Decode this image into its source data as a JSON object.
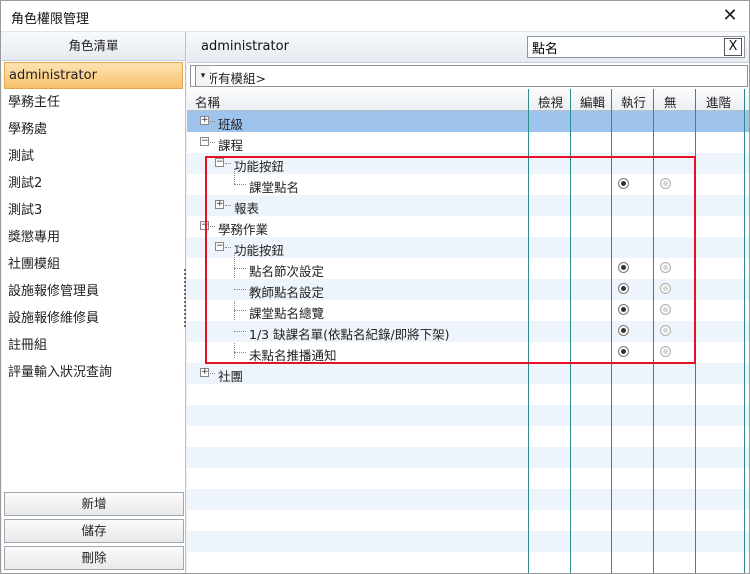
{
  "window": {
    "title": "角色權限管理",
    "close_glyph": "✕"
  },
  "left_panel": {
    "header": "角色清單",
    "roles": [
      "administrator",
      "學務主任",
      "學務處",
      "測試",
      "測試2",
      "測試3",
      "獎懲專用",
      "社團模組",
      "設施報修管理員",
      "設施報修維修員",
      "註冊組",
      "評量輸入狀況查詢"
    ],
    "selected_index": 0,
    "buttons": {
      "add": "新增",
      "save": "儲存",
      "delete": "刪除"
    }
  },
  "right_panel": {
    "role_title": "administrator",
    "search": {
      "value": "點名",
      "clear_label": "X"
    },
    "module_select": {
      "value": "<所有模組>",
      "dropdown_glyph": "▾"
    },
    "columns": {
      "name": "名稱",
      "view": "檢視",
      "edit": "編輯",
      "execute": "執行",
      "none": "無",
      "advanced": "進階"
    },
    "tree": [
      {
        "label": "班級",
        "expander": "+",
        "level": 0
      },
      {
        "label": "課程",
        "expander": "−",
        "level": 0
      },
      {
        "label": "功能按鈕",
        "expander": "−",
        "level": 1
      },
      {
        "label": "課堂點名",
        "level": 2,
        "selected": "execute"
      },
      {
        "label": "報表",
        "expander": "+",
        "level": 1
      },
      {
        "label": "學務作業",
        "expander": "−",
        "level": 0
      },
      {
        "label": "功能按鈕",
        "expander": "−",
        "level": 1
      },
      {
        "label": "點名節次設定",
        "level": 2,
        "selected": "execute"
      },
      {
        "label": "教師點名設定",
        "level": 2,
        "selected": "execute"
      },
      {
        "label": "課堂點名總覽",
        "level": 2,
        "selected": "execute"
      },
      {
        "label": "1/3 缺課名單(依點名紀錄/即將下架)",
        "level": 2,
        "selected": "execute"
      },
      {
        "label": "未點名推播通知",
        "level": 2,
        "selected": "execute"
      },
      {
        "label": "社團",
        "expander": "+",
        "level": 0
      }
    ]
  },
  "colors": {
    "selection": "#f9c26b",
    "highlight_row": "#9ec3ec",
    "callout": "#e81123",
    "grid_line": "#2e8b8b"
  }
}
